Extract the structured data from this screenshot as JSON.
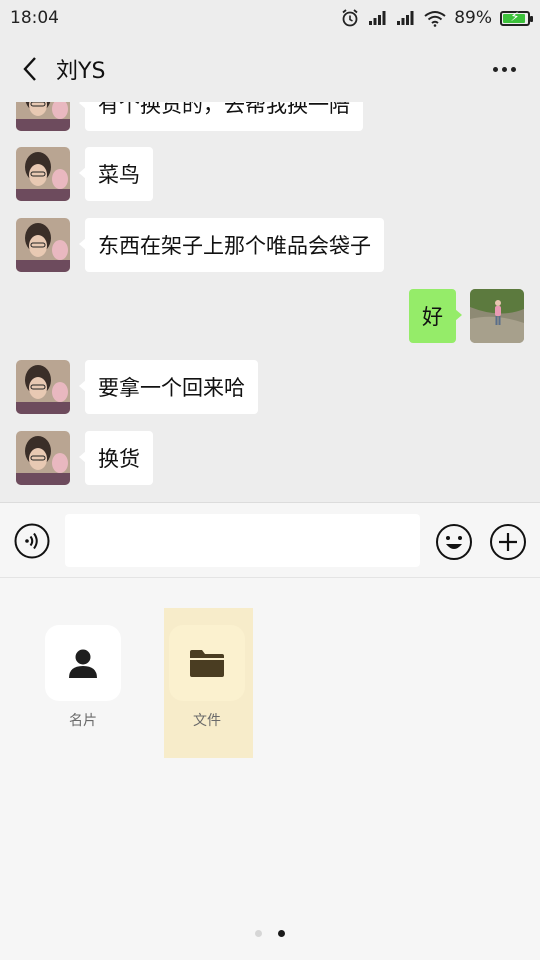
{
  "status_bar": {
    "time": "18:04",
    "battery_percent": "89%",
    "icons": [
      "alarm-icon",
      "signal-icon",
      "signal-icon",
      "wifi-icon",
      "battery-icon"
    ]
  },
  "nav": {
    "title": "刘YS",
    "back_icon": "chevron-left-icon",
    "more_icon": "more-dots-icon"
  },
  "messages": [
    {
      "side": "in",
      "text": "有个换货的，去帮我换一陪"
    },
    {
      "side": "in",
      "text": "菜鸟"
    },
    {
      "side": "in",
      "text": "东西在架子上那个唯品会袋子"
    },
    {
      "side": "out",
      "text": "好"
    },
    {
      "side": "in",
      "text": "要拿一个回来哈"
    },
    {
      "side": "in",
      "text": "换货"
    }
  ],
  "input": {
    "value": "",
    "placeholder": "",
    "voice_icon": "voice-icon",
    "emoji_icon": "emoji-icon",
    "plus_icon": "plus-icon"
  },
  "panel": {
    "items": [
      {
        "label": "名片",
        "icon": "person-icon"
      },
      {
        "label": "文件",
        "icon": "folder-icon"
      }
    ],
    "pages": 2,
    "current_page": 2
  },
  "colors": {
    "outgoing_bubble": "#95ec69",
    "incoming_bubble": "#ffffff",
    "highlight": "#f7ecca",
    "background": "#ededed"
  }
}
